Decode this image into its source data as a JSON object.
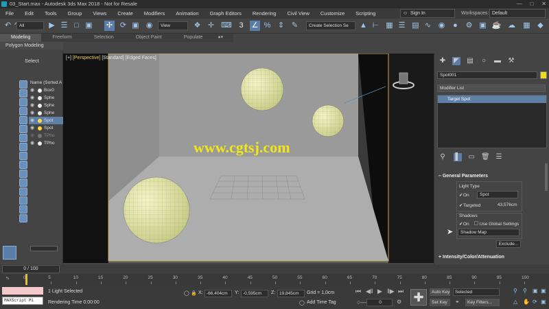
{
  "window": {
    "title": "03_Start.max - Autodesk 3ds Max 2018 - Not for Resale"
  },
  "menu": {
    "items": [
      "File",
      "Edit",
      "Tools",
      "Group",
      "Views",
      "Create",
      "Modifiers",
      "Animation",
      "Graph Editors",
      "Rendering",
      "Civil View",
      "Customize",
      "Scripting"
    ],
    "sign_in": "Sign In",
    "workspaces_label": "Workspaces:",
    "workspace_value": "Default"
  },
  "toolbar": {
    "filter_value": "All",
    "coord_value": "View",
    "selection_set_placeholder": "Create Selection Se"
  },
  "ribbon": {
    "tabs": [
      "Modeling",
      "Freeform",
      "Selection",
      "Object Paint",
      "Populate"
    ],
    "active_tab": "Modeling",
    "sub_label": "Polygon Modeling"
  },
  "scene_explorer": {
    "title": "Select",
    "header": "Name (Sorted A",
    "rows": [
      {
        "name": "Box0",
        "selected": false,
        "dim": false
      },
      {
        "name": "Sphe",
        "selected": false,
        "dim": false
      },
      {
        "name": "Sphe",
        "selected": false,
        "dim": false
      },
      {
        "name": "Sphe",
        "selected": false,
        "dim": false
      },
      {
        "name": "Spot",
        "selected": true,
        "dim": false
      },
      {
        "name": "Spot",
        "selected": false,
        "dim": false
      },
      {
        "name": "TPho",
        "selected": false,
        "dim": true
      },
      {
        "name": "TPho",
        "selected": false,
        "dim": false
      }
    ]
  },
  "viewport": {
    "label_prefix": "[+]",
    "label_view": "[Perspective]",
    "label_shading": "[Standard]",
    "label_edges": "[Edged Faces]",
    "watermark": "www.cgtsj.com"
  },
  "command_panel": {
    "object_name": "Spot001",
    "object_color": "#f0dc1e",
    "modifier_list_label": "Modifier List",
    "stack_item": "Target Spot",
    "general_params_title": "General Parameters",
    "light_type_label": "Light Type",
    "on_label": "On",
    "light_type_value": "Spot",
    "targeted_label": "Targeted",
    "targeted_distance": "43,576cm",
    "shadows_label": "Shadows",
    "shadows_on_label": "On",
    "use_global_label": "Use Global Settings",
    "shadow_type_value": "Shadow Map",
    "exclude_button": "Exclude...",
    "intensity_rollout_title": "Intensity/Color/Attenuation"
  },
  "timeslider": {
    "frame_text": "0 / 100"
  },
  "trackbar": {
    "ticks": [
      "0",
      "5",
      "10",
      "15",
      "20",
      "25",
      "30",
      "35",
      "40",
      "45",
      "50",
      "55",
      "60",
      "65",
      "70",
      "75",
      "80",
      "85",
      "90",
      "95",
      "100"
    ]
  },
  "status": {
    "maxscript_label": "MAXScript Mi",
    "selection_text": "1 Light Selected",
    "render_time_text": "Rendering Time 0:00:00",
    "x_label": "X:",
    "x_value": "-66,404cm",
    "y_label": "Y:",
    "y_value": "-0,595cm",
    "z_label": "Z:",
    "z_value": "19,845cm",
    "grid_text": "Grid = 1,0cm",
    "add_time_tag": "Add Time Tag",
    "frame_field": "0",
    "auto_key": "Auto Key",
    "set_key": "Set Key",
    "selected_dropdown": "Selected",
    "key_filters": "Key Filters...",
    "autokey_color": "#c6282d"
  }
}
